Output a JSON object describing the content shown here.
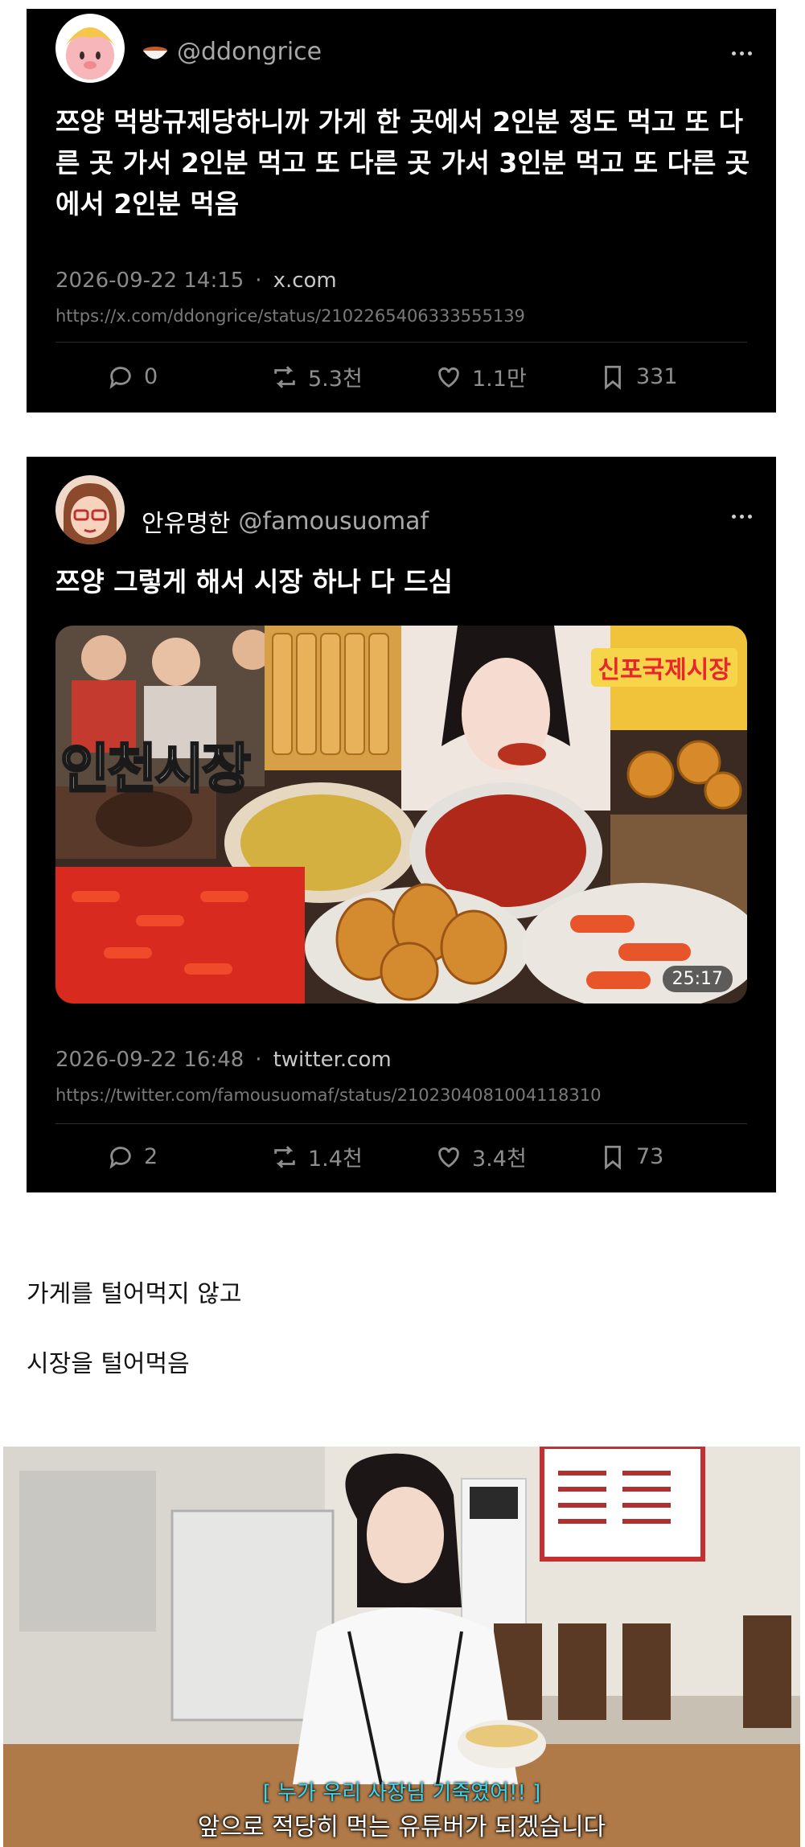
{
  "tweets": [
    {
      "handle": "@ddongrice",
      "display_name": "",
      "text": "쯔양 먹방규제당하니까 가게 한 곳에서 2인분 정도 먹고 또 다른 곳 가서 2인분 먹고 또 다른 곳 가서 3인분 먹고 또 다른 곳에서 2인분 먹음",
      "datetime": "2026-09-22 14:15",
      "domain": "x.com",
      "url": "https://x.com/ddongrice/status/2102265406333555139",
      "replies": "0",
      "retweets": "5.3천",
      "likes": "1.1만",
      "bookmarks": "331"
    },
    {
      "handle": "@famousuomaf",
      "display_name": "안유명한",
      "text": "쯔양 그렇게 해서 시장 하나 다 드심",
      "datetime": "2026-09-22 16:48",
      "domain": "twitter.com",
      "url": "https://twitter.com/famousuomaf/status/2102304081004118310",
      "replies": "2",
      "retweets": "1.4천",
      "likes": "3.4천",
      "bookmarks": "73",
      "media": {
        "title": "인천시장",
        "sign": "신포국제시장",
        "duration": "25:17"
      }
    }
  ],
  "body_lines": [
    "가게를 털어먹지 않고",
    "시장을 털어먹음"
  ],
  "photo": {
    "subtitle_top": "[ 누가 우리 사장님 기죽였어!! ]",
    "subtitle_bottom": "앞으로 적당히 먹는 유튜버가 되겠습니다"
  },
  "icons": [
    "more-icon",
    "reply-icon",
    "retweet-icon",
    "like-icon",
    "bookmark-icon",
    "bowl-icon"
  ],
  "colors": {
    "card_bg": "#000000",
    "muted": "#8a8a8a",
    "subtitle_cyan": "#3ad6f0"
  }
}
